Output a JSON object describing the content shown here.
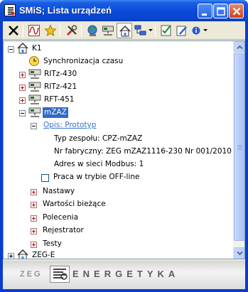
{
  "window": {
    "title": "SMiS; Lista urządzeń"
  },
  "tree": {
    "items": [
      {
        "label": "K1"
      },
      {
        "label": "Synchronizacja czasu"
      },
      {
        "label": "RITz-430"
      },
      {
        "label": "RITz-421"
      },
      {
        "label": "RFT-451"
      },
      {
        "label": "mZAZ"
      },
      {
        "label": "Opis: Prototyp"
      },
      {
        "label": "Typ zespołu: CPZ-mZAZ"
      },
      {
        "label": "Nr fabryczny: ZEG mZAZ1116-230 Nr 001/2010"
      },
      {
        "label": "Adres w sieci Modbus: 1"
      },
      {
        "label": "Praca w trybie OFF-line"
      },
      {
        "label": "Nastawy"
      },
      {
        "label": "Wartości bieżące"
      },
      {
        "label": "Polecenia"
      },
      {
        "label": "Rejestrator"
      },
      {
        "label": "Testy"
      },
      {
        "label": "ZEG-E"
      }
    ]
  },
  "footer": {
    "brand_left": "ZEG",
    "brand_right": "ENERGETYKA"
  },
  "colors": {
    "titlebar": "#0a4ad8",
    "selection": "#316ac5",
    "link": "#3a74c8"
  }
}
